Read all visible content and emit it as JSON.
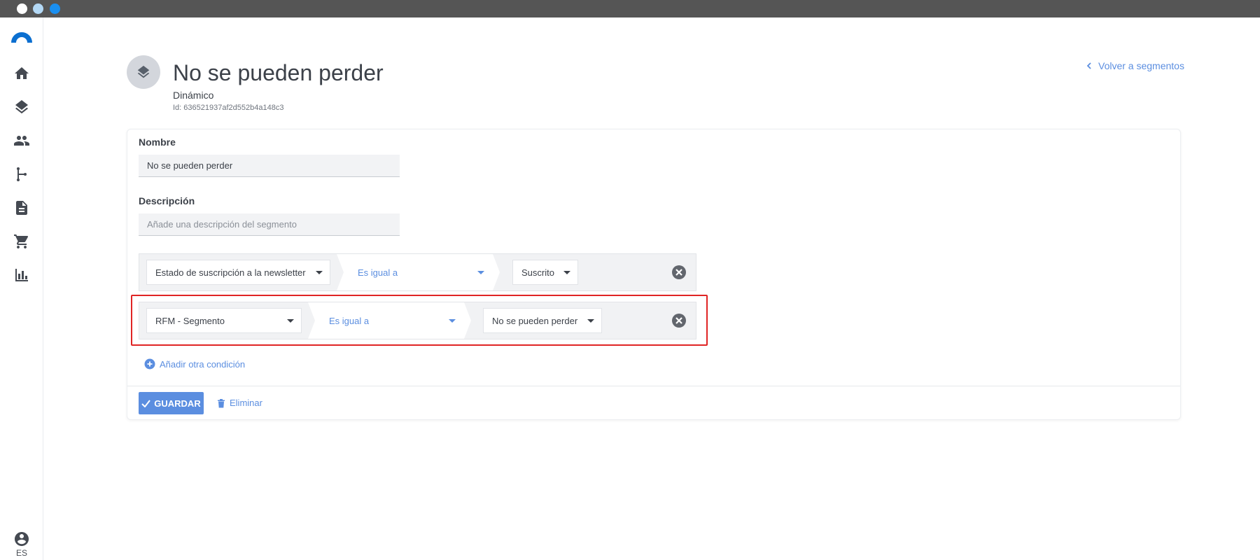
{
  "window": {
    "controls": [
      "close",
      "minimize",
      "maximize"
    ],
    "control_colors": [
      "#ffffff",
      "#b3d8f5",
      "#1a8ff0"
    ]
  },
  "sidebar": {
    "items": [
      {
        "icon": "home-icon"
      },
      {
        "icon": "layers-icon"
      },
      {
        "icon": "people-icon"
      },
      {
        "icon": "flow-icon"
      },
      {
        "icon": "document-icon"
      },
      {
        "icon": "cart-icon"
      },
      {
        "icon": "chart-icon"
      }
    ],
    "language": "ES"
  },
  "header": {
    "title": "No se pueden perder",
    "type": "Dinámico",
    "id_text": "Id: 636521937af2d552b4a148c3",
    "back_link": "Volver a segmentos"
  },
  "form": {
    "name_label": "Nombre",
    "name_value": "No se pueden perder",
    "description_label": "Descripción",
    "description_placeholder": "Añade una descripción del segmento",
    "conditions": [
      {
        "field": "Estado de suscripción a la newsletter",
        "operator": "Es igual a",
        "value": "Suscrito"
      },
      {
        "field": "RFM - Segmento",
        "operator": "Es igual a",
        "value": "No se pueden perder",
        "highlighted": true
      }
    ],
    "add_condition": "Añadir otra condición",
    "save_label": "GUARDAR",
    "delete_label": "Eliminar"
  },
  "colors": {
    "accent": "#5b8ee0",
    "highlight": "#e02424",
    "logo": "#0b6fd0"
  }
}
